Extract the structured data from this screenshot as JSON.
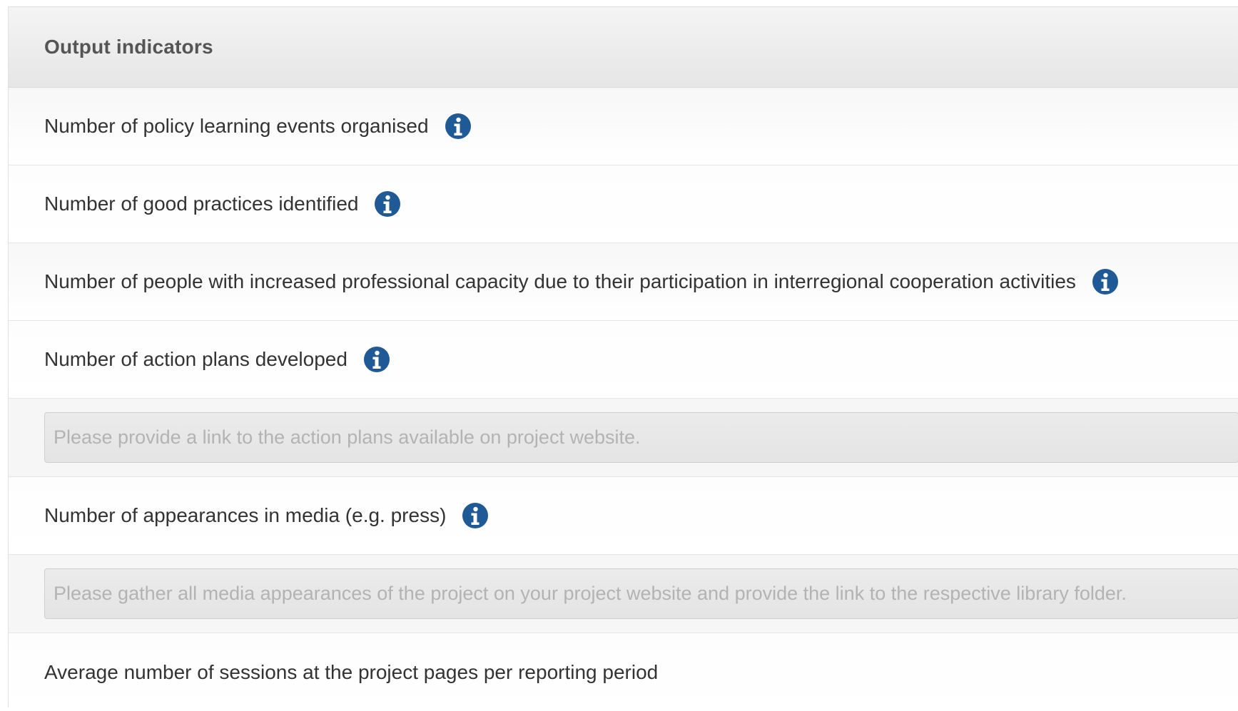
{
  "panel": {
    "title": "Output indicators"
  },
  "indicators": [
    {
      "label": "Number of policy learning events organised",
      "icon": "info-icon"
    },
    {
      "label": "Number of good practices identified",
      "icon": "info-icon"
    },
    {
      "label": "Number of people with increased professional capacity due to their participation in interregional cooperation activities",
      "icon": "info-icon"
    },
    {
      "label": "Number of action plans developed",
      "icon": "info-icon"
    },
    {
      "label": "Number of appearances in media (e.g. press)",
      "icon": "info-icon"
    },
    {
      "label": "Average number of sessions at the project pages per reporting period"
    }
  ],
  "inputs": {
    "action_plans_link": {
      "value": "",
      "placeholder": "Please provide a link to the action plans available on project website."
    },
    "media_link": {
      "value": "",
      "placeholder": "Please gather all media appearances of the project on your project website and provide the link to the respective library folder."
    }
  },
  "colors": {
    "info_icon": "#1f5a96",
    "header_bg": "#ececec",
    "label_text": "#333333",
    "placeholder_text": "#b3b3b3"
  }
}
